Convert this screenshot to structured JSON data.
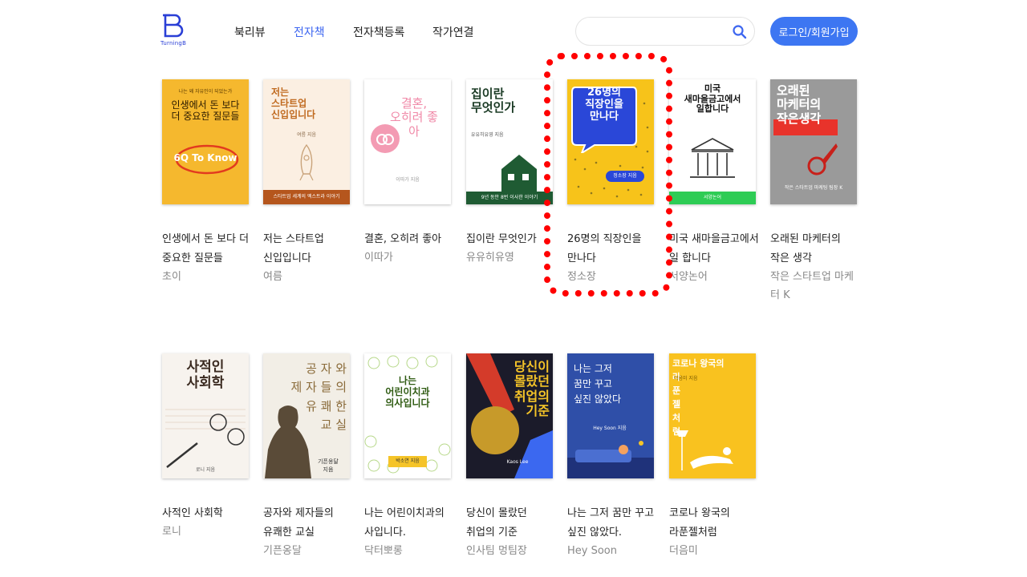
{
  "header": {
    "brand": "TurningB",
    "nav": [
      "북리뷰",
      "전자책",
      "전자책등록",
      "작가연결"
    ],
    "active_nav": "전자책",
    "search_placeholder": "",
    "login_label": "로그인/회원가입"
  },
  "books": [
    {
      "title": "인생에서 돈 보다 더 중요한 질문들",
      "author": "초이",
      "cover_text": "인생에서 돈 보다\n더 중요한 질문들",
      "cover_sub": "나는 왜 자유인이 되었는가",
      "cover_badge": "6Q To Know",
      "cover_color": "#f5b82e"
    },
    {
      "title": "저는 스타트업 신입입니다",
      "author": "여름",
      "cover_text": "저는\n스타트업\n신입입니다",
      "cover_sub": "여름 지음",
      "cover_band": "스타트업 세계의 엑스트라 이야기",
      "cover_color": "#fbefe2"
    },
    {
      "title": "결혼, 오히려 좋아",
      "author": "이따가",
      "cover_text": "결혼,\n오히려 좋아",
      "cover_sub": "이따가 지음",
      "cover_color": "#ffffff"
    },
    {
      "title": "집이란 무엇인가",
      "author": "유유히유영",
      "cover_text": "집이란\n무엇인가",
      "cover_sub": "유유히유영 지음",
      "cover_band": "9년 동안 8번 이사한 이야기",
      "cover_color": "#ffffff"
    },
    {
      "title": "26명의 직장인을 만나다",
      "author": "정소장",
      "cover_text": "26명의\n직장인을\n만나다",
      "cover_sub": "정소장 지음",
      "cover_color": "#f7c31a"
    },
    {
      "title": "미국 새마을금고에서 일 합니다",
      "author": "서양논어",
      "cover_text": "미국\n새마을금고에서\n일합니다",
      "cover_band": "서양논어",
      "cover_color": "#ffffff"
    },
    {
      "title": "오래된 마케터의 작은 생각",
      "author": "작은 스타트업 마케터 K",
      "cover_text": "오래된\n마케터의\n작은생각",
      "cover_sub": "작은 스타트업 마케팅 팀장 K",
      "cover_color": "#9a9a9a"
    },
    {
      "title": "사적인 사회학",
      "author": "로니",
      "cover_text": "사적인\n사회학",
      "cover_sub": "로니 지음",
      "cover_color": "#f7f3ee"
    },
    {
      "title": "공자와 제자들의 유쾌한 교실",
      "author": "기픈옹달",
      "cover_text": "공 자 와\n제 자 들 의\n유 쾌 한\n교 실",
      "cover_sub": "기픈옹달\n지음",
      "cover_color": "#f2eee6"
    },
    {
      "title": "나는 어린이치과의 사입니다.",
      "author": "닥터뽀롱",
      "cover_text": "나는\n어린이치과\n의사입니다",
      "cover_sub": "박소연 지음",
      "cover_color": "#ffffff"
    },
    {
      "title": "당신이 몰랐던 취업의 기준",
      "author": "인사팀 멍팀장",
      "cover_text": "당신이\n몰랐던\n취업의\n기준",
      "cover_sub": "Kaos Lee",
      "cover_color": "#1b1b2a"
    },
    {
      "title": "나는 그저 꿈만 꾸고 싶진 않았다.",
      "author": "Hey Soon",
      "cover_text": "나는 그저\n꿈만 꾸고\n싶진 않았다",
      "cover_sub": "Hey Soon 지음",
      "cover_color": "#2f4fa8"
    },
    {
      "title": "코로나 왕국의 라푼젤처럼",
      "author": "더음미",
      "cover_text": "코로나 왕국의\n라\n푼\n젤\n처\n럼",
      "cover_sub": "더음미 지음",
      "cover_color": "#f9c21f"
    }
  ]
}
